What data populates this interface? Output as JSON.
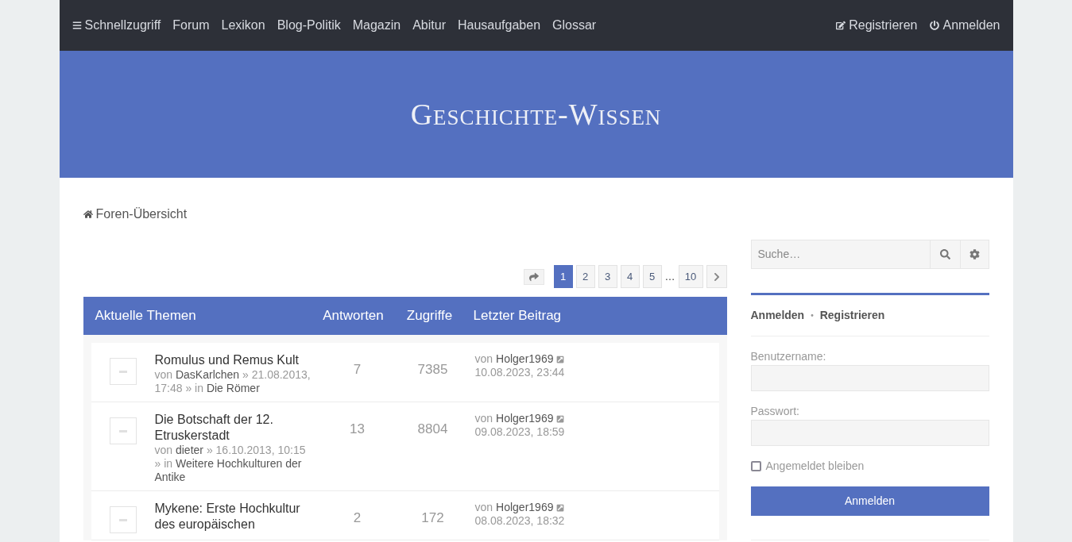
{
  "nav": {
    "quick_access": "Schnellzugriff",
    "items": [
      "Forum",
      "Lexikon",
      "Blog-Politik",
      "Magazin",
      "Abitur",
      "Hausaufgaben",
      "Glossar"
    ],
    "register": "Registrieren",
    "login": "Anmelden"
  },
  "banner": {
    "site_title": "Geschichte-Wissen"
  },
  "breadcrumb": "Foren-Übersicht",
  "pagination": {
    "pages": [
      {
        "label": "1",
        "selected": true
      },
      {
        "label": "2",
        "selected": false
      },
      {
        "label": "3",
        "selected": false
      },
      {
        "label": "4",
        "selected": false
      },
      {
        "label": "5",
        "selected": false
      }
    ],
    "ellipsis": "…",
    "last": "10"
  },
  "table": {
    "columns": [
      "Aktuelle Themen",
      "Antworten",
      "Zugriffe",
      "Letzter Beitrag"
    ],
    "rows": [
      {
        "title": "Romulus und Remus Kult",
        "meta_by": "von",
        "author": "DasKarlchen",
        "meta_date": "» 21.08.2013, 17:48 » in",
        "forum": "Die Römer",
        "replies": "7",
        "views": "7385",
        "last_by": "von",
        "last_author": "Holger1969",
        "last_date": "10.08.2023, 23:44"
      },
      {
        "title": "Die Botschaft der 12. Etruskerstadt",
        "meta_by": "von",
        "author": "dieter",
        "meta_date": "» 16.10.2013, 10:15 » in",
        "forum": "Weitere Hochkulturen der Antike",
        "replies": "13",
        "views": "8804",
        "last_by": "von",
        "last_author": "Holger1969",
        "last_date": "09.08.2023, 18:59"
      },
      {
        "title": "Mykene: Erste Hochkultur des europäischen",
        "replies": "2",
        "views": "172",
        "last_by": "von",
        "last_author": "Holger1969",
        "last_date": "08.08.2023, 18:32"
      }
    ]
  },
  "sidebar": {
    "search_placeholder": "Suche…",
    "tabs": [
      "Anmelden",
      "Registrieren"
    ],
    "separator": "•",
    "username_label": "Benutzername:",
    "password_label": "Passwort:",
    "remember": {
      "label": "Angemeldet bleiben",
      "checked": false
    },
    "submit": "Anmelden"
  }
}
